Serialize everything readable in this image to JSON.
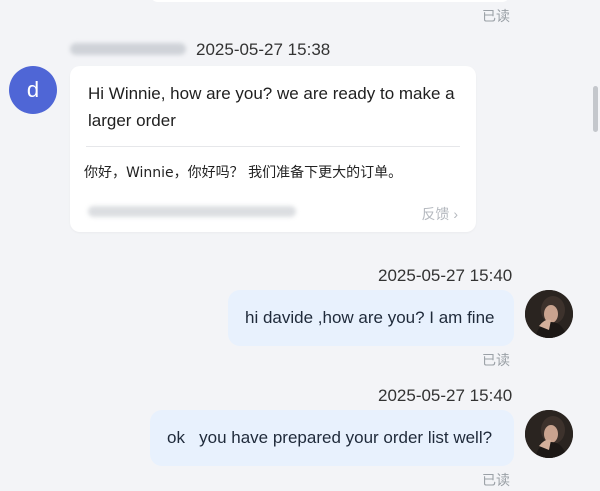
{
  "read_labels": [
    "已读",
    "已读",
    "已读"
  ],
  "incoming": {
    "avatar_letter": "d",
    "timestamp": "2025-05-27 15:38",
    "message": "Hi Winnie, how are you? we are ready to make a larger order",
    "translation": "你好，Winnie，你好吗？ 我们准备下更大的订单。",
    "feedback_label": "反馈 ›"
  },
  "outgoing": [
    {
      "timestamp": "2025-05-27 15:40",
      "message": "hi davide ,how are you? I am fine"
    },
    {
      "timestamp": "2025-05-27 15:40",
      "message": "ok   you have prepared your order list well?"
    }
  ],
  "colors": {
    "background": "#f3f4f7",
    "incoming_avatar": "#4f66d6",
    "outgoing_bubble": "#e8f1fd",
    "incoming_card": "#ffffff",
    "read_text": "#9aa0a6"
  }
}
